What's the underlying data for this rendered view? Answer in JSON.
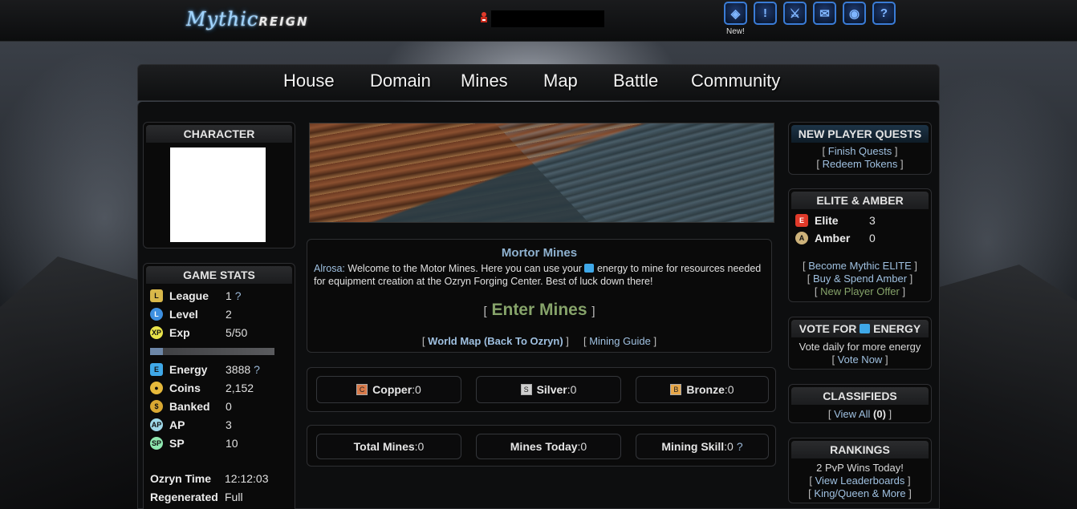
{
  "brand": {
    "logo_a": "Mythic",
    "logo_b": "REIGN"
  },
  "top_icons": {
    "new_label": "New!"
  },
  "nav": [
    "House",
    "Domain",
    "Mines",
    "Map",
    "Battle",
    "Community"
  ],
  "character": {
    "title": "CHARACTER"
  },
  "game_stats": {
    "title": "GAME STATS",
    "league": {
      "label": "League",
      "value": "1",
      "help": "?"
    },
    "level": {
      "label": "Level",
      "value": "2"
    },
    "exp": {
      "label": "Exp",
      "value": "5/50"
    },
    "energy": {
      "label": "Energy",
      "value": "3888",
      "help": "?"
    },
    "coins": {
      "label": "Coins",
      "value": "2,152"
    },
    "banked": {
      "label": "Banked",
      "value": "0"
    },
    "ap": {
      "label": "AP",
      "value": "3"
    },
    "sp": {
      "label": "SP",
      "value": "10"
    },
    "time": {
      "label": "Ozryn Time",
      "value": "12:12:03"
    },
    "regen": {
      "label": "Regenerated",
      "value": "Full"
    },
    "exp_fraction": 0.1
  },
  "mine": {
    "title": "Mortor Mines",
    "speaker": "Alrosa:",
    "text_a": "Welcome to the Motor Mines. Here you can use your",
    "text_b": "energy to mine for resources",
    "text_c": "needed for equipment creation at the Ozryn Forging Center. Best of luck down there!",
    "enter": "Enter Mines",
    "world_map": "World Map (Back To Ozryn)",
    "guide": "Mining Guide"
  },
  "resources": {
    "copper": {
      "label": "Copper",
      "value": "0"
    },
    "silver": {
      "label": "Silver",
      "value": "0"
    },
    "bronze": {
      "label": "Bronze",
      "value": "0"
    }
  },
  "mining_stats": {
    "total": {
      "label": "Total Mines",
      "value": "0"
    },
    "today": {
      "label": "Mines Today",
      "value": "0"
    },
    "skill": {
      "label": "Mining Skill",
      "value": "0",
      "help": "?"
    }
  },
  "quests": {
    "title": "NEW PLAYER QUESTS",
    "finish": "Finish Quests",
    "redeem": "Redeem Tokens"
  },
  "elite": {
    "title": "ELITE & AMBER",
    "elite_label": "Elite",
    "elite_value": "3",
    "amber_label": "Amber",
    "amber_value": "0",
    "become": "Become Mythic ELITE",
    "buy": "Buy & Spend Amber",
    "offer": "New Player Offer"
  },
  "vote": {
    "title_a": "VOTE FOR",
    "title_b": "ENERGY",
    "text": "Vote daily for more energy",
    "link": "Vote Now"
  },
  "classifieds": {
    "title": "CLASSIFIEDS",
    "link": "View All",
    "count": "(0)"
  },
  "rankings": {
    "title": "RANKINGS",
    "wins": "2 PvP Wins Today!",
    "leader": "View Leaderboards",
    "king": "King/Queen & More"
  },
  "colors": {
    "accent": "#3a7cd6",
    "link": "#9fc0e0",
    "panel": "#0a0a0a"
  }
}
